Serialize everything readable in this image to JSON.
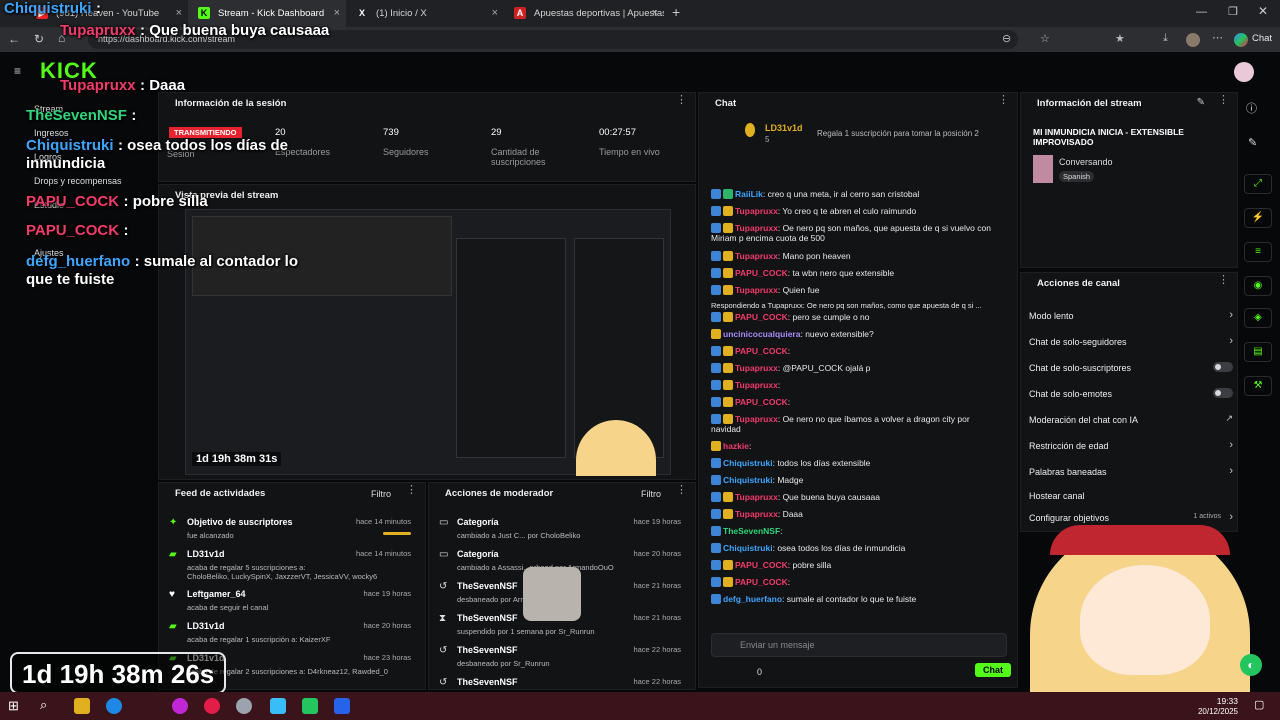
{
  "browser": {
    "tabs": [
      {
        "label": "(981) Heaven - YouTube"
      },
      {
        "label": "Stream - Kick Dashboard"
      },
      {
        "label": "(1) Inicio / X"
      },
      {
        "label": "Apuestas deportivas | Apuestas on"
      }
    ],
    "url": "https://dashboard.kick.com/stream",
    "chat_button": "Chat"
  },
  "dashboard": {
    "logo": "KICK",
    "nav": [
      "Stream",
      "Ingresos",
      "Logros",
      "Drops y recompensas",
      "Estudio",
      "Ajustes"
    ],
    "session": {
      "title": "Información de la sesión",
      "live_badge": "TRANSMITIENDO",
      "session_label": "Sesión",
      "stats": [
        {
          "value": "20",
          "label": "Espectadores"
        },
        {
          "value": "739",
          "label": "Seguidores"
        },
        {
          "value": "29",
          "label": "Cantidad de suscripciones"
        },
        {
          "value": "00:27:57",
          "label": "Tiempo en vivo"
        }
      ]
    },
    "preview": {
      "title": "Vista previa del stream",
      "timer": "1d 19h 38m 31s"
    },
    "feed": {
      "title": "Feed de actividades",
      "filter": "Filtro",
      "items": [
        {
          "title": "Objetivo de suscriptores",
          "sub": "fue alcanzado",
          "time": "hace 14 minutos"
        },
        {
          "title": "LD31v1d",
          "sub": "acaba de regalar 5 suscripciones a:",
          "sub2": "CholoBeliko, LuckySpinX, JaxzzerVT, JessicaVV, wocky6",
          "time": "hace 14 minutos"
        },
        {
          "title": "Leftgamer_64",
          "sub": "acaba de seguir el canal",
          "time": "hace 19 horas"
        },
        {
          "title": "LD31v1d",
          "sub": "acaba de regalar 1 suscripción a: KaizerXF",
          "time": "hace 20 horas"
        },
        {
          "title": "LD31v1d",
          "sub": "acaba de regalar 2 suscripciones a: D4rkneaz12, Rawded_0",
          "time": "hace 23 horas"
        }
      ]
    },
    "mod": {
      "title": "Acciones de moderador",
      "filter": "Filtro",
      "items": [
        {
          "title": "Categoría",
          "sub": "cambiado a Just C... por CholoBeliko",
          "time": "hace 19 horas"
        },
        {
          "title": "Categoría",
          "sub": "cambiado a Assassi...erhood por ArmandoOuO",
          "time": "hace 20 horas"
        },
        {
          "title": "TheSevenNSF",
          "sub": "desbaneado por ArmandoOuO",
          "time": "hace 21 horas"
        },
        {
          "title": "TheSevenNSF",
          "sub": "suspendido por 1 semana por Sr_Runrun",
          "time": "hace 21 horas"
        },
        {
          "title": "TheSevenNSF",
          "sub": "desbaneado por Sr_Runrun",
          "time": "hace 22 horas"
        },
        {
          "title": "TheSevenNSF",
          "sub": "",
          "time": "hace 22 horas"
        }
      ]
    },
    "chat": {
      "title": "Chat",
      "pinned_user": "LD31v1d",
      "pinned_count": "5",
      "pinned_text": "Regala 1 suscripción para tomar la posición 2",
      "messages": [
        {
          "user": "RaiiLik",
          "text": "creo q una meta, ir al cerro san cristobal",
          "c": "u2"
        },
        {
          "user": "Tupapruxx",
          "text": "Yo creo q te abren el culo raimundo",
          "c": "u1"
        },
        {
          "user": "Tupapruxx",
          "text": "Oe nero pq son maños, que apuesta de q si vuelvo con Miriam p encima cuota de 500",
          "c": "u1"
        },
        {
          "user": "Tupapruxx",
          "text": "Mano pon heaven",
          "c": "u1"
        },
        {
          "user": "PAPU_COCK",
          "text": "ta wbn nero que extensible",
          "c": "u1"
        },
        {
          "user": "Tupapruxx",
          "text": "Quien fue",
          "c": "u1"
        },
        {
          "user": "",
          "text": "Respondiendo a Tupapruxx: Oe nero pq son maños, como que apuesta de q si ...",
          "c": "muted"
        },
        {
          "user": "PAPU_COCK",
          "text": "pero se cumple o no",
          "c": "u1"
        },
        {
          "user": "uncinicocualquiera",
          "text": "nuevo extensible?",
          "c": "u3"
        },
        {
          "user": "PAPU_COCK",
          "text": "",
          "c": "u1"
        },
        {
          "user": "Tupapruxx",
          "text": "@PAPU_COCK ojalá p",
          "c": "u1"
        },
        {
          "user": "Tupapruxx",
          "text": "",
          "c": "u1"
        },
        {
          "user": "PAPU_COCK",
          "text": "",
          "c": "u1"
        },
        {
          "user": "Tupapruxx",
          "text": "Oe nero no que íbamos a volver a dragon city por navidad",
          "c": "u1"
        },
        {
          "user": "hazkie",
          "text": "",
          "c": "u1"
        },
        {
          "user": "Chiquistruki",
          "text": "todos los días extensible",
          "c": "u2"
        },
        {
          "user": "Chiquistruki",
          "text": "Madge",
          "c": "u2"
        },
        {
          "user": "Tupapruxx",
          "text": "Que buena buya causaaa",
          "c": "u1"
        },
        {
          "user": "Tupapruxx",
          "text": "Daaa",
          "c": "u1"
        },
        {
          "user": "TheSevenNSF",
          "text": "",
          "c": "u4"
        },
        {
          "user": "Chiquistruki",
          "text": "osea todos los días de inmundicia",
          "c": "u2"
        },
        {
          "user": "PAPU_COCK",
          "text": "pobre silla",
          "c": "u1"
        },
        {
          "user": "PAPU_COCK",
          "text": "",
          "c": "u1"
        },
        {
          "user": "defg_huerfano",
          "text": "sumale al contador lo que te fuiste",
          "c": "u2"
        }
      ],
      "input_placeholder": "Enviar un mensaje",
      "viewers": "0",
      "send": "Chat"
    },
    "stream_info": {
      "title": "Información del stream",
      "stream_title": "MI INMUNDICIA INICIA - EXTENSIBLE IMPROVISADO",
      "category": "Conversando",
      "language": "Spanish"
    },
    "actions": {
      "title": "Acciones de canal",
      "items": [
        {
          "label": "Modo lento",
          "ctl": "chev"
        },
        {
          "label": "Chat de solo-seguidores",
          "ctl": "chev"
        },
        {
          "label": "Chat de solo-suscriptores",
          "ctl": "toggle"
        },
        {
          "label": "Chat de solo-emotes",
          "ctl": "toggle"
        },
        {
          "label": "Moderación del chat con IA",
          "ctl": "ext"
        },
        {
          "label": "Restricción de edad",
          "ctl": "chev"
        },
        {
          "label": "Palabras baneadas",
          "ctl": "chev"
        },
        {
          "label": "Hostear canal",
          "ctl": "none"
        },
        {
          "label": "Configurar objetivos",
          "ctl": "chev"
        }
      ],
      "active_label": "1 activos"
    }
  },
  "overlay": {
    "chat": [
      {
        "user": "Chiquistruki",
        "msg": ":"
      },
      {
        "user": "Tupapruxx",
        "msg": ": Que buena buya causaaa"
      },
      {
        "user": "Tupapruxx",
        "msg": ": Daaa"
      },
      {
        "user": "TheSevenNSF",
        "msg": ":"
      },
      {
        "user": "Chiquistruki",
        "msg": ": osea todos los días de inmundicia"
      },
      {
        "user": "PAPU_COCK",
        "msg": ": pobre silla"
      },
      {
        "user": "PAPU_COCK",
        "msg": ":"
      },
      {
        "user": "defg_huerfano",
        "msg": ": sumale al contador lo que te fuiste"
      }
    ],
    "timer": "1d 19h 38m 26s"
  },
  "taskbar": {
    "time": "19:33",
    "date": "20/12/2025"
  }
}
